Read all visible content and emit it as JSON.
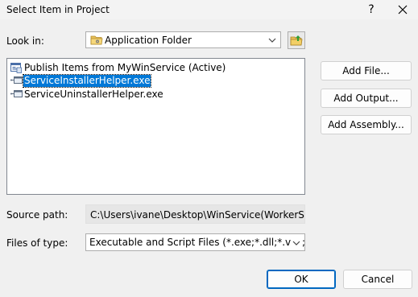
{
  "window": {
    "title": "Select Item in Project",
    "help_glyph": "?",
    "close_icon": "close-icon"
  },
  "look_in": {
    "label": "Look in:",
    "value": "Application Folder",
    "folder_icon": "folder-icon",
    "up_icon": "up-folder-icon"
  },
  "file_list": {
    "items": [
      {
        "label": "Publish Items from MyWinService (Active)",
        "icon": "publish-items-icon",
        "selected": false
      },
      {
        "label": "ServiceInstallerHelper.exe",
        "icon": "exe-file-icon",
        "selected": true
      },
      {
        "label": "ServiceUninstallerHelper.exe",
        "icon": "exe-file-icon",
        "selected": false
      }
    ]
  },
  "side_buttons": {
    "add_file": "Add File...",
    "add_output": "Add Output...",
    "add_assembly": "Add Assembly..."
  },
  "source_path": {
    "label": "Source path:",
    "value": "C:\\Users\\ivane\\Desktop\\WinService(WorkerService"
  },
  "files_of_type": {
    "label": "Files of type:",
    "value": "Executable and Script Files (*.exe;*.dll;*.vbs;*.js)"
  },
  "footer": {
    "ok": "OK",
    "cancel": "Cancel"
  },
  "colors": {
    "background": "#f0f0f0",
    "selection": "#0078d7",
    "default_button_border": "#0067c0"
  }
}
